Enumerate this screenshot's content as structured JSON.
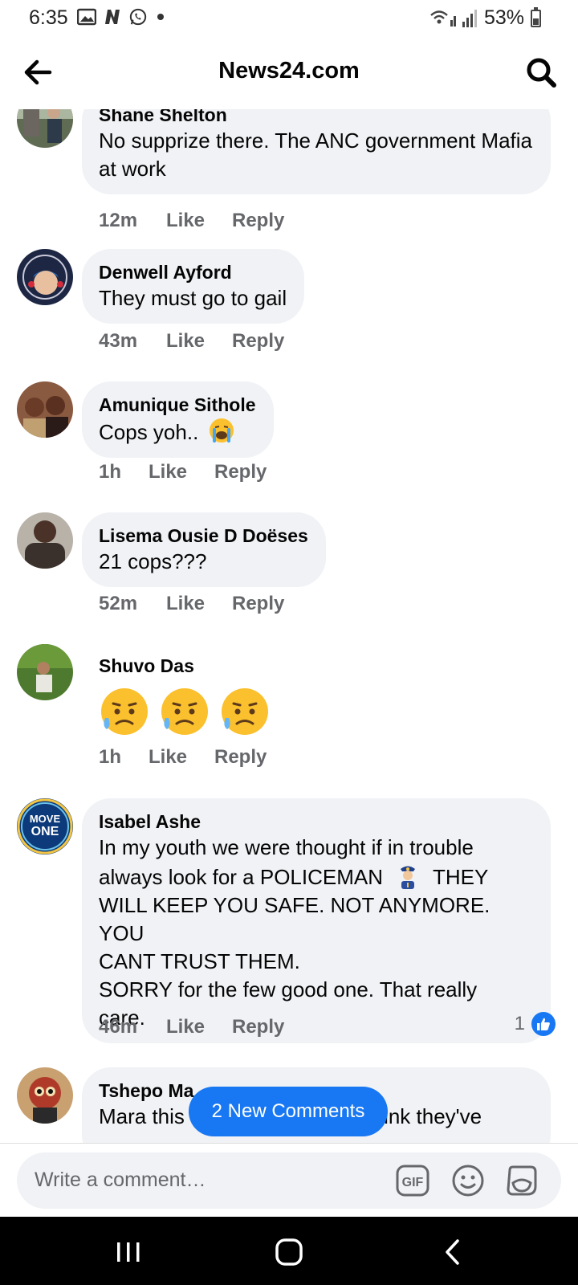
{
  "status_bar": {
    "time": "6:35",
    "battery": "53%",
    "battery_level": 0.53
  },
  "header": {
    "title": "News24.com"
  },
  "comments": [
    {
      "name": "Shane Shelton",
      "text": "No supprize there. The ANC government Mafia at work",
      "time": "12m",
      "like": "Like",
      "reply": "Reply"
    },
    {
      "name": "Denwell Ayford",
      "text": "They must go to gail",
      "time": "43m",
      "like": "Like",
      "reply": "Reply"
    },
    {
      "name": "Amunique Sithole",
      "text": "Cops yoh..",
      "time": "1h",
      "like": "Like",
      "reply": "Reply"
    },
    {
      "name": "Lisema Ousie D Doëses",
      "text": "21 cops???",
      "time": "52m",
      "like": "Like",
      "reply": "Reply"
    },
    {
      "name": "Shuvo Das",
      "text": "",
      "time": "1h",
      "like": "Like",
      "reply": "Reply"
    },
    {
      "name": "Isabel Ashe",
      "text_lines": [
        "In my youth we were thought if in trouble",
        "always look for a POLICEMAN",
        "THEY",
        "WILL KEEP YOU SAFE. NOT ANYMORE. YOU",
        "CANT TRUST THEM.",
        "SORRY for the few good one. That really",
        "care."
      ],
      "time": "46m",
      "like": "Like",
      "reply": "Reply",
      "reaction_count": "1"
    },
    {
      "name": "Tshepo Ma",
      "text": "Mara this busieus called",
      "text_tail": "think they've"
    }
  ],
  "new_comments_label": "2 New Comments",
  "composer": {
    "placeholder": "Write a comment…",
    "gif_label": "GIF"
  },
  "colors": {
    "accent": "#1877f2",
    "bubble": "#f0f2f5",
    "meta": "#65676b"
  },
  "icons": {
    "back": "arrow-left-icon",
    "search": "search-icon",
    "gif": "gif-icon",
    "emoji": "smiley-icon",
    "sticker": "sticker-icon"
  }
}
